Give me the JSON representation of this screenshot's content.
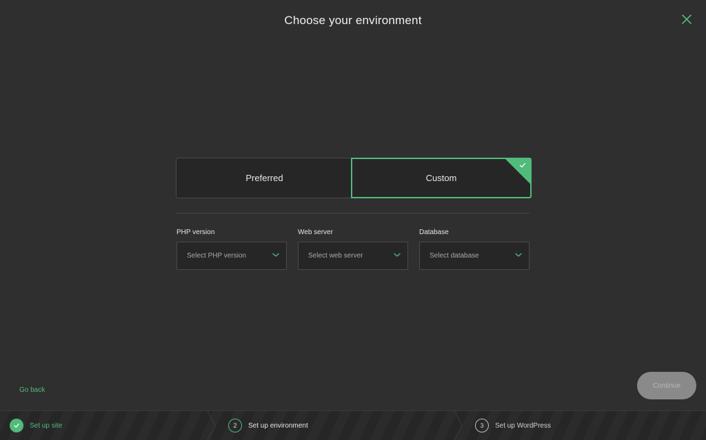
{
  "header": {
    "title": "Choose your environment"
  },
  "tabs": [
    {
      "label": "Preferred",
      "selected": false
    },
    {
      "label": "Custom",
      "selected": true
    }
  ],
  "fields": {
    "php": {
      "label": "PHP version",
      "placeholder": "Select PHP version"
    },
    "web_server": {
      "label": "Web server",
      "placeholder": "Select web server"
    },
    "database": {
      "label": "Database",
      "placeholder": "Select database"
    }
  },
  "footer": {
    "back_label": "Go back",
    "continue_label": "Continue"
  },
  "steps": [
    {
      "number": "1",
      "label": "Set up site",
      "state": "done"
    },
    {
      "number": "2",
      "label": "Set up environment",
      "state": "active"
    },
    {
      "number": "3",
      "label": "Set up WordPress",
      "state": "todo"
    }
  ],
  "colors": {
    "accent": "#51bb7b",
    "background": "#2f2f2f"
  }
}
